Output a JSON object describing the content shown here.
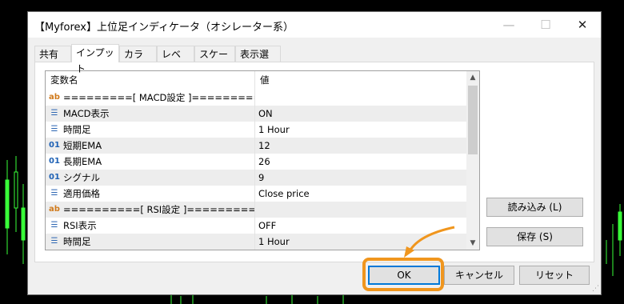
{
  "window": {
    "title": "【Myforex】上位足インディケータ（オシレーター系）",
    "minimize_glyph": "—",
    "maximize_glyph": "☐",
    "close_glyph": "✕"
  },
  "tabs": [
    {
      "label": "共有"
    },
    {
      "label": "インプット",
      "active": true
    },
    {
      "label": "カラー"
    },
    {
      "label": "レベル"
    },
    {
      "label": "スケール"
    },
    {
      "label": "表示選択"
    }
  ],
  "grid": {
    "columns": [
      "変数名",
      "値"
    ],
    "rows": [
      {
        "icon": "ab",
        "name": "=========[ MACD設定 ]===========",
        "value": ""
      },
      {
        "icon": "list",
        "name": "MACD表示",
        "value": "ON"
      },
      {
        "icon": "list",
        "name": "時間足",
        "value": "1 Hour"
      },
      {
        "icon": "01",
        "name": "短期EMA",
        "value": "12"
      },
      {
        "icon": "01",
        "name": "長期EMA",
        "value": "26"
      },
      {
        "icon": "01",
        "name": "シグナル",
        "value": "9"
      },
      {
        "icon": "list",
        "name": "適用価格",
        "value": "Close price"
      },
      {
        "icon": "ab",
        "name": "==========[ RSI設定 ]============",
        "value": ""
      },
      {
        "icon": "list",
        "name": "RSI表示",
        "value": "OFF"
      },
      {
        "icon": "list",
        "name": "時間足",
        "value": "1 Hour"
      }
    ]
  },
  "side_buttons": {
    "load_label": "読み込み (L)",
    "save_label": "保存 (S)"
  },
  "footer_buttons": {
    "ok_label": "OK",
    "cancel_label": "キャンセル",
    "reset_label": "リセット"
  },
  "colors": {
    "highlight": "#f0961e",
    "dialog_bg": "#f0f0f0",
    "chart_candle": "#33ff33"
  }
}
